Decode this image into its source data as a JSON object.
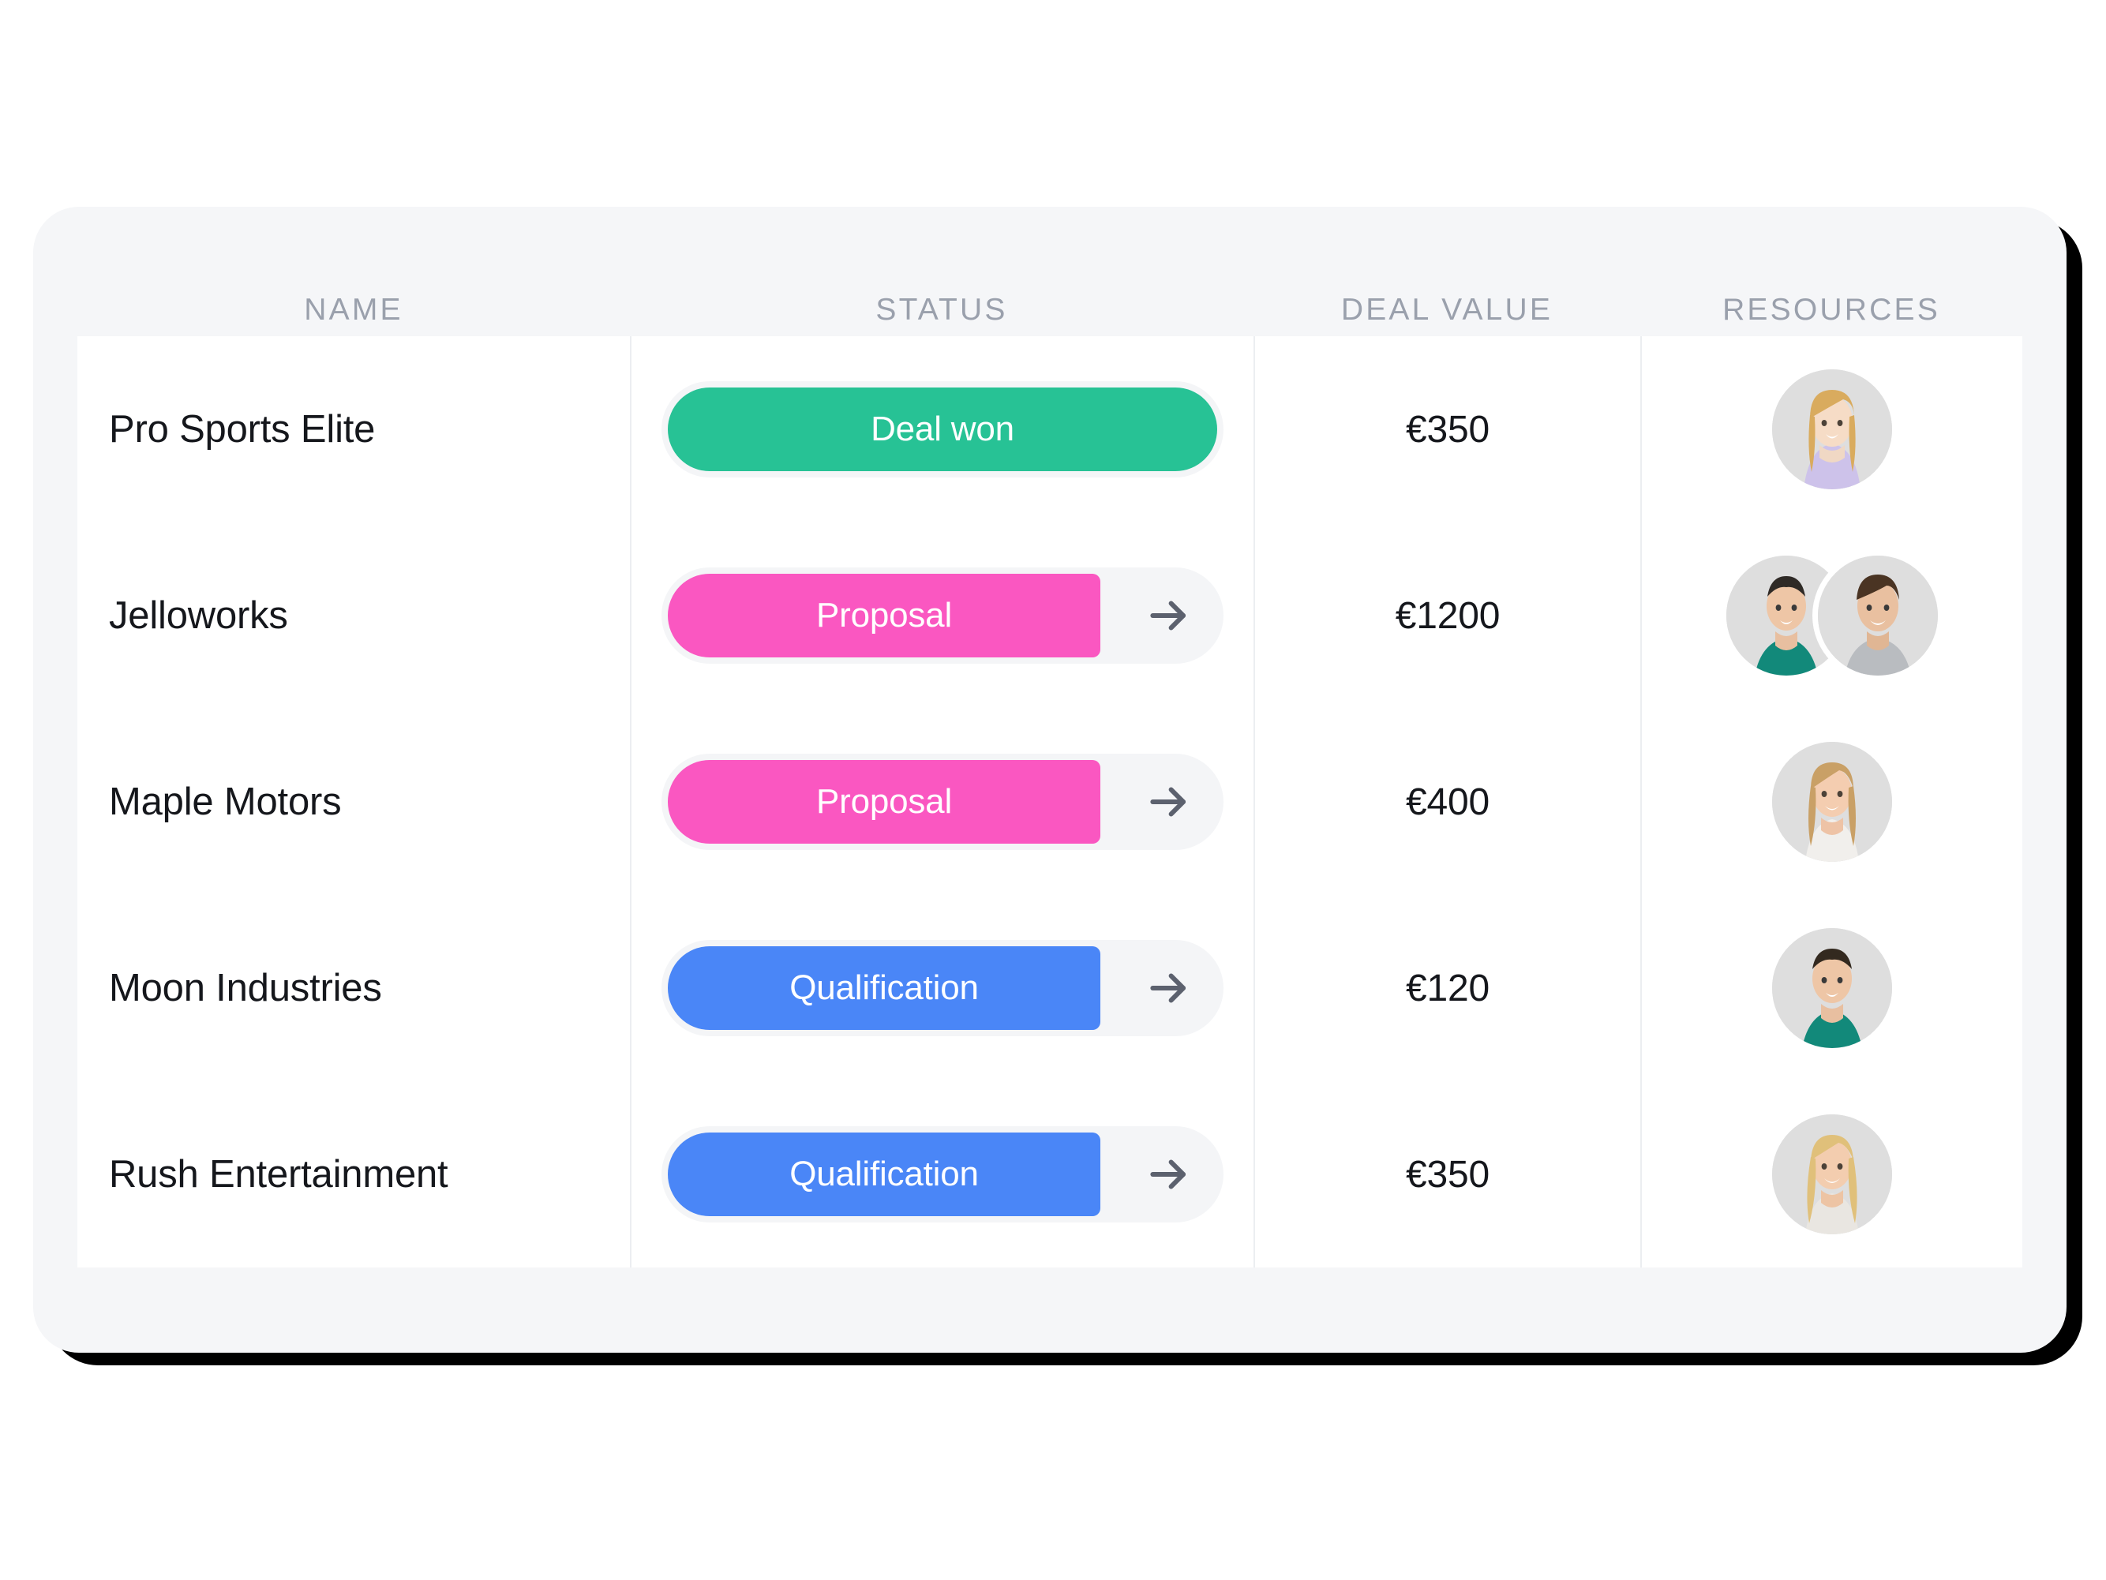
{
  "table": {
    "columns": [
      {
        "key": "name",
        "label": "NAME"
      },
      {
        "key": "status",
        "label": "STATUS"
      },
      {
        "key": "value",
        "label": "DEAL VALUE"
      },
      {
        "key": "res",
        "label": "RESOURCES"
      }
    ],
    "rows": [
      {
        "name": "Pro Sports Elite",
        "status": {
          "label": "Deal won",
          "color": "#27c295",
          "fill": "full",
          "arrow": false
        },
        "value": "€350",
        "resources": [
          {
            "person": "woman-blonde-lilac"
          }
        ]
      },
      {
        "name": "Jelloworks",
        "status": {
          "label": "Proposal",
          "color": "#fa57c1",
          "fill": "partial",
          "arrow": true
        },
        "value": "€1200",
        "resources": [
          {
            "person": "man-teal-shirt"
          },
          {
            "person": "man-grey-shirt"
          }
        ]
      },
      {
        "name": "Maple Motors",
        "status": {
          "label": "Proposal",
          "color": "#fa57c1",
          "fill": "partial",
          "arrow": true
        },
        "value": "€400",
        "resources": [
          {
            "person": "woman-blonde-white-top"
          }
        ]
      },
      {
        "name": "Moon Industries",
        "status": {
          "label": "Qualification",
          "color": "#4a86f7",
          "fill": "partial",
          "arrow": true
        },
        "value": "€120",
        "resources": [
          {
            "person": "man-teal-shirt-2"
          }
        ]
      },
      {
        "name": "Rush Entertainment",
        "status": {
          "label": "Qualification",
          "color": "#4a86f7",
          "fill": "partial",
          "arrow": true
        },
        "value": "€350",
        "resources": [
          {
            "person": "woman-blonde-smiling"
          }
        ]
      }
    ]
  },
  "theme": {
    "status_deal_won": "#27c295",
    "status_proposal": "#fa57c1",
    "status_qualification": "#4a86f7",
    "track_bg": "#f4f5f7",
    "header_bg": "#f5f6f8",
    "header_text": "#9aa0ac",
    "body_text": "#15171c",
    "arrow_color": "#5c616e",
    "avatar_bg": "#dedede",
    "frame": "#000000"
  },
  "icons": {
    "arrow": "arrow-right-icon"
  }
}
